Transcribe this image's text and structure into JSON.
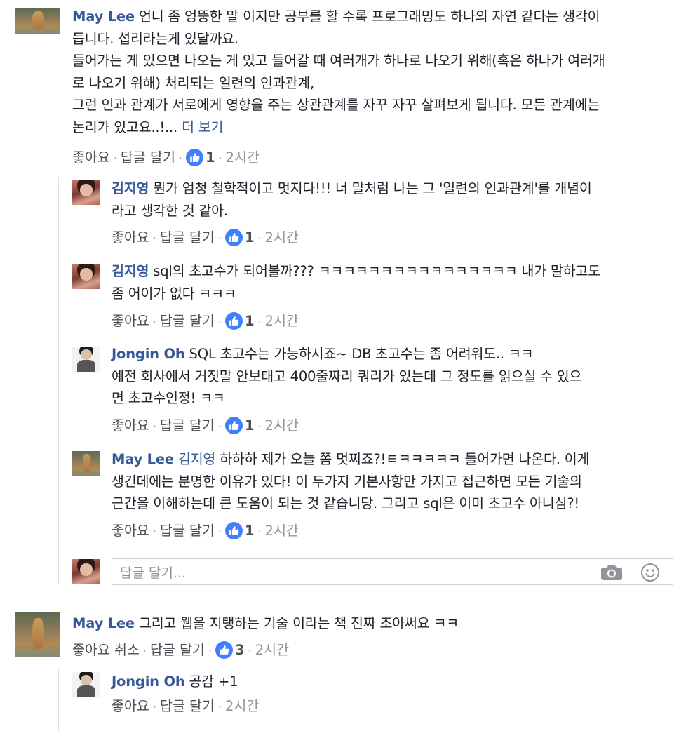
{
  "comments": [
    {
      "author": "May Lee",
      "lines": [
        "언니 좀 엉뚱한 말 이지만 공부를 할 수록 프로그래밍도 하나의 자연 같다는 생각이",
        "듭니다. 섭리라는게 있달까요.",
        "들어가는 게 있으면 나오는 게 있고 들어갈 때 여러개가 하나로 나오기 위해(혹은 하나가 여러개",
        "로 나오기 위해) 처리되는 일련의 인과관계,",
        "그런 인과 관계가 서로에게 영향을 주는 상관관계를 자꾸 자꾸 살펴보게 됩니다. 모든 관계에는",
        "논리가 있고요..!..."
      ],
      "more": "더 보기",
      "like": "좋아요",
      "reply": "답글 달기",
      "likes": "1",
      "time": "2시간",
      "replies": [
        {
          "author": "김지영",
          "lines": [
            "뭔가 엄청 철학적이고 멋지다!!! 너 말처럼 나는 그 '일련의 인과관계'를 개념이",
            "라고 생각한 것 같아."
          ],
          "like": "좋아요",
          "reply": "답글 달기",
          "likes": "1",
          "time": "2시간"
        },
        {
          "author": "김지영",
          "lines": [
            "sql의 초고수가 되어볼까??? ㅋㅋㅋㅋㅋㅋㅋㅋㅋㅋㅋㅋㅋㅋㅋㅋ 내가 말하고도",
            "좀 어이가 없다 ㅋㅋㅋ"
          ],
          "like": "좋아요",
          "reply": "답글 달기",
          "likes": "1",
          "time": "2시간"
        },
        {
          "author": "Jongin Oh",
          "lines": [
            "SQL 초고수는 가능하시죠~ DB 초고수는 좀 어려워도.. ㅋㅋ",
            "예전 회사에서 거짓말 안보태고 400줄짜리 쿼리가 있는데 그 정도를 읽으실 수 있으",
            "면 초고수인정! ㅋㅋ"
          ],
          "like": "좋아요",
          "reply": "답글 달기",
          "likes": "1",
          "time": "2시간"
        },
        {
          "author": "May Lee",
          "mention": "김지영",
          "lines": [
            "하하하 제가 오늘 쫌 멋찌죠?!ㅌㅋㅋㅋㅋㅋ 들어가면 나온다. 이게",
            "생긴데에는 분명한 이유가 있다! 이 두가지 기본사항만 가지고 접근하면 모든 기술의",
            "근간을 이해하는데 큰 도움이 되는 것 같습니당. 그리고 sql은 이미 초고수 아니심?!"
          ],
          "like": "좋아요",
          "reply": "답글 달기",
          "likes": "1",
          "time": "2시간"
        }
      ],
      "reply_input": {
        "placeholder": "답글 달기..."
      }
    },
    {
      "author": "May Lee",
      "lines": [
        "그리고 웹을 지탱하는 기술 이라는 책 진짜 조아써요 ㅋㅋ"
      ],
      "like": "좋아요 취소",
      "reply": "답글 달기",
      "likes": "3",
      "time": "2시간",
      "replies": [
        {
          "author": "Jongin Oh",
          "lines": [
            "공감 +1"
          ],
          "like": "좋아요",
          "reply": "답글 달기",
          "time": "2시간"
        }
      ]
    }
  ],
  "separator": "·",
  "icons": {
    "like": "thumbs-up-icon",
    "camera": "camera-icon",
    "emoji": "smiley-icon"
  },
  "colors": {
    "link": "#365899",
    "like_badge": "#4080ff",
    "meta": "#90949c"
  }
}
